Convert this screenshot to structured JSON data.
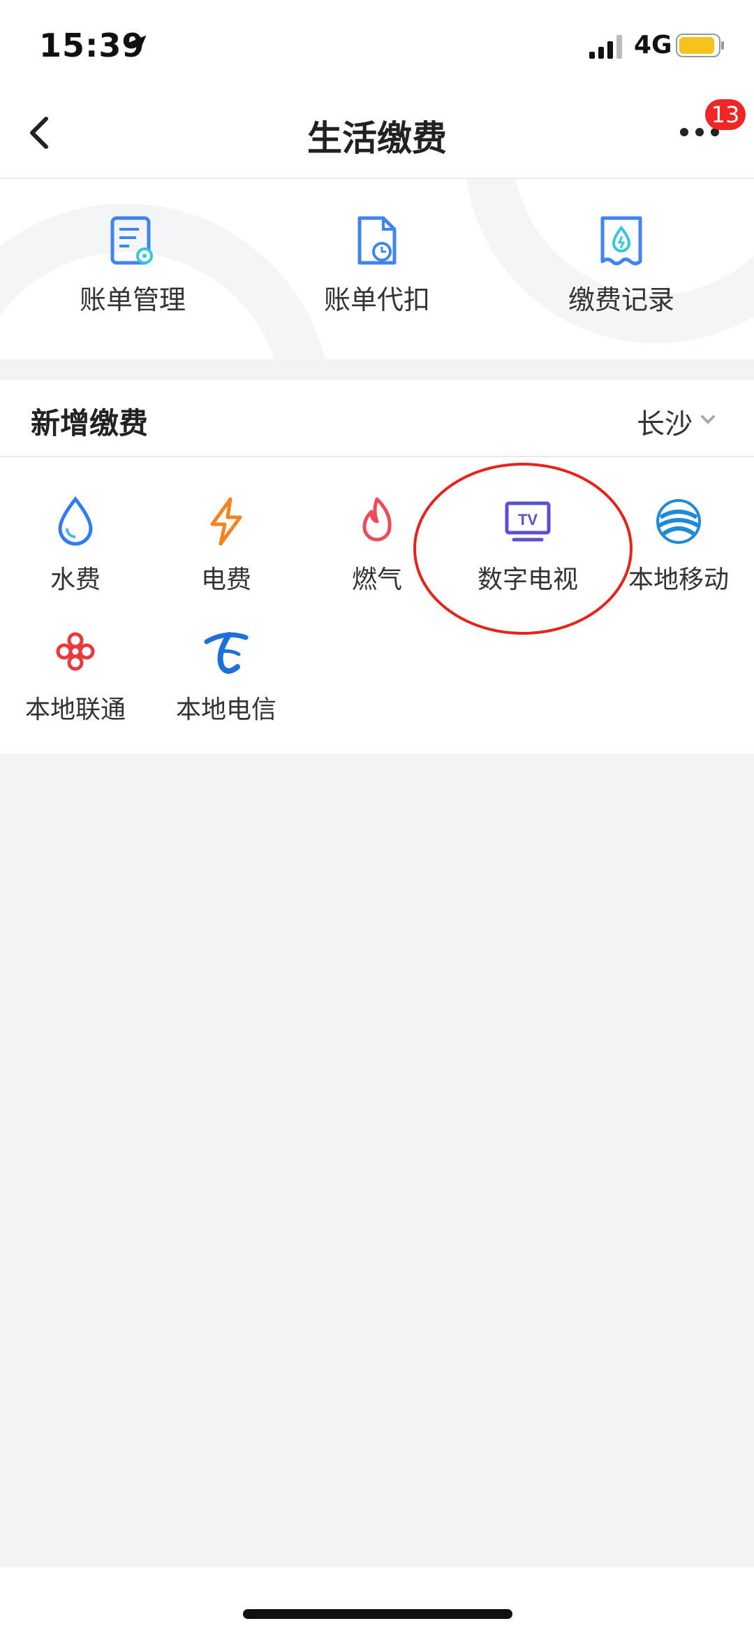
{
  "status_bar": {
    "time": "15:39",
    "network": "4G",
    "icons": [
      "location-arrow-icon",
      "signal-icon",
      "battery-icon"
    ]
  },
  "nav": {
    "title": "生活缴费",
    "back_icon": "chevron-left-icon",
    "more_icon": "more-dots-icon",
    "badge": "13"
  },
  "quick_actions": [
    {
      "label": "账单管理",
      "icon": "bill-settings-icon"
    },
    {
      "label": "账单代扣",
      "icon": "bill-clock-icon"
    },
    {
      "label": "缴费记录",
      "icon": "receipt-drop-icon"
    }
  ],
  "section": {
    "title": "新增缴费",
    "city": "长沙"
  },
  "services": [
    {
      "label": "水费",
      "icon": "water-drop-icon"
    },
    {
      "label": "电费",
      "icon": "lightning-icon"
    },
    {
      "label": "燃气",
      "icon": "flame-icon"
    },
    {
      "label": "数字电视",
      "icon": "tv-icon"
    },
    {
      "label": "本地移动",
      "icon": "china-mobile-icon"
    },
    {
      "label": "本地联通",
      "icon": "china-unicom-icon"
    },
    {
      "label": "本地电信",
      "icon": "china-telecom-icon"
    }
  ],
  "colors": {
    "accent_blue": "#2f7cf6",
    "badge_red": "#f02525",
    "highlight_red": "#e8211b",
    "background": "#f3f3f2"
  }
}
